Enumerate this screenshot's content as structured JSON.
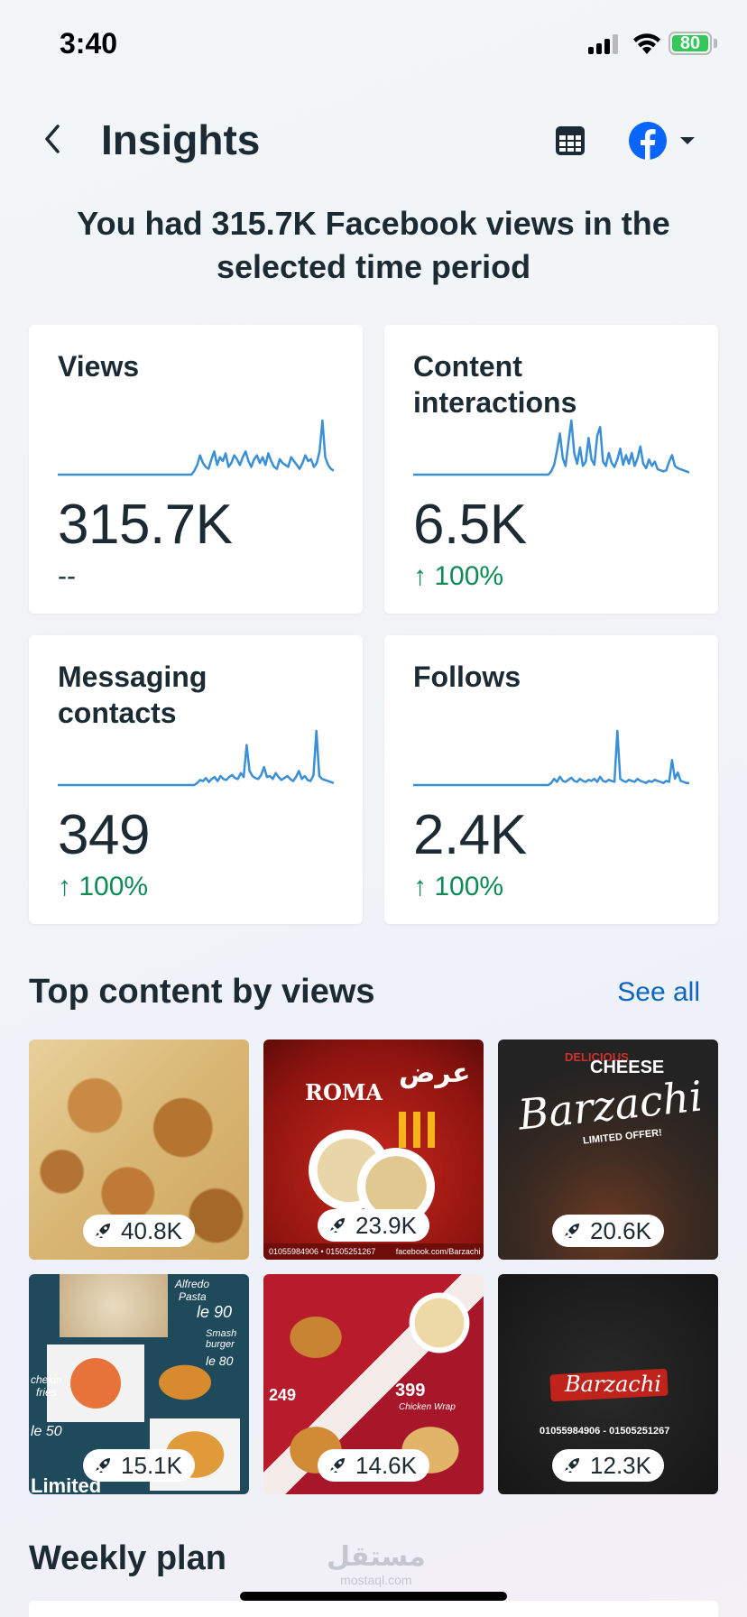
{
  "status_bar": {
    "time": "3:40",
    "battery": "80"
  },
  "header": {
    "title": "Insights"
  },
  "headline": "You had 315.7K Facebook views in the selected time period",
  "metrics": [
    {
      "label": "Views",
      "value": "315.7K",
      "change": "--",
      "trend": "none",
      "sparkline": [
        0,
        0,
        0,
        0,
        0,
        0,
        0,
        0,
        0,
        0,
        0,
        0,
        0,
        0,
        0,
        0,
        0,
        0,
        0,
        0,
        0,
        0,
        0,
        0,
        0,
        0,
        0,
        0,
        0,
        0,
        0,
        0,
        0,
        0,
        0,
        0,
        0,
        0,
        0,
        0,
        0,
        0,
        0,
        0,
        0,
        0,
        0,
        0,
        2,
        5,
        10,
        6,
        4,
        3,
        8,
        12,
        5,
        9,
        7,
        11,
        4,
        6,
        10,
        8,
        5,
        9,
        12,
        7,
        4,
        8,
        10,
        6,
        9,
        5,
        11,
        7,
        4,
        3,
        8,
        6,
        5,
        4,
        9,
        7,
        5,
        3,
        6,
        10,
        7,
        8,
        4,
        6,
        12,
        28,
        9,
        5,
        3,
        2
      ]
    },
    {
      "label": "Content interactions",
      "value": "6.5K",
      "change": "100%",
      "trend": "up",
      "sparkline": [
        0,
        0,
        0,
        0,
        0,
        0,
        0,
        0,
        0,
        0,
        0,
        0,
        0,
        0,
        0,
        0,
        0,
        0,
        0,
        0,
        0,
        0,
        0,
        0,
        0,
        0,
        0,
        0,
        0,
        0,
        0,
        0,
        0,
        0,
        0,
        0,
        0,
        0,
        0,
        0,
        0,
        0,
        0,
        0,
        0,
        0,
        0,
        0,
        3,
        9,
        22,
        38,
        15,
        8,
        30,
        50,
        20,
        10,
        25,
        8,
        12,
        34,
        14,
        9,
        36,
        44,
        12,
        8,
        20,
        11,
        7,
        14,
        24,
        9,
        18,
        10,
        20,
        8,
        15,
        26,
        10,
        6,
        14,
        8,
        12,
        5,
        4,
        3,
        4,
        12,
        18,
        8,
        6,
        5,
        4,
        3,
        2
      ]
    },
    {
      "label": "Messaging contacts",
      "value": "349",
      "change": "100%",
      "trend": "up",
      "sparkline": [
        0,
        0,
        0,
        0,
        0,
        0,
        0,
        0,
        0,
        0,
        0,
        0,
        0,
        0,
        0,
        0,
        0,
        0,
        0,
        0,
        0,
        0,
        0,
        0,
        0,
        0,
        0,
        0,
        0,
        0,
        0,
        0,
        0,
        0,
        0,
        0,
        0,
        0,
        0,
        0,
        0,
        0,
        0,
        0,
        0,
        0,
        0,
        0,
        2,
        5,
        4,
        7,
        3,
        6,
        8,
        4,
        9,
        6,
        5,
        8,
        10,
        7,
        6,
        12,
        8,
        40,
        14,
        9,
        7,
        6,
        10,
        18,
        8,
        9,
        6,
        12,
        8,
        5,
        7,
        9,
        6,
        4,
        8,
        14,
        6,
        9,
        5,
        4,
        10,
        54,
        9,
        6,
        5,
        4,
        3,
        2
      ]
    },
    {
      "label": "Follows",
      "value": "2.4K",
      "change": "100%",
      "trend": "up",
      "sparkline": [
        0,
        0,
        0,
        0,
        0,
        0,
        0,
        0,
        0,
        0,
        0,
        0,
        0,
        0,
        0,
        0,
        0,
        0,
        0,
        0,
        0,
        0,
        0,
        0,
        0,
        0,
        0,
        0,
        0,
        0,
        0,
        0,
        0,
        0,
        0,
        0,
        0,
        0,
        0,
        0,
        0,
        0,
        0,
        0,
        0,
        0,
        0,
        0,
        2,
        6,
        3,
        8,
        4,
        3,
        5,
        7,
        4,
        3,
        6,
        4,
        3,
        5,
        4,
        6,
        3,
        8,
        4,
        3,
        5,
        4,
        3,
        52,
        6,
        4,
        3,
        5,
        4,
        3,
        6,
        4,
        3,
        2,
        4,
        3,
        5,
        4,
        3,
        2,
        4,
        3,
        24,
        6,
        12,
        4,
        3,
        2,
        2
      ]
    }
  ],
  "top_content": {
    "title": "Top content by views",
    "see_all": "See all",
    "items": [
      {
        "views": "40.8K",
        "art": "pasta-chicken"
      },
      {
        "views": "23.9K",
        "art": "roma-offer",
        "texts": [
          "ROMA",
          "عرض",
          "01055984906 • 01505251267",
          "facebook.com/Barzachi"
        ]
      },
      {
        "views": "20.6K",
        "art": "barzachi-cheese",
        "texts": [
          "DELICIOUS",
          "CHEESE",
          "Barzachi",
          "LIMITED OFFER!"
        ]
      },
      {
        "views": "15.1K",
        "art": "menu-collage",
        "texts": [
          "Alfredo",
          "Pasta",
          "le 90",
          "Smash",
          "burger",
          "le 80",
          "chekin",
          "fries",
          "le 50",
          "Limited"
        ]
      },
      {
        "views": "14.6K",
        "art": "burger-wrap",
        "texts": [
          "249",
          "399",
          "Chicken Wrap"
        ]
      },
      {
        "views": "12.3K",
        "art": "barzachi-dark",
        "texts": [
          "Barzachi",
          "01055984906 - 01505251267"
        ]
      }
    ]
  },
  "weekly_plan": {
    "title": "Weekly plan"
  },
  "watermark": {
    "arabic": "مستقل",
    "latin": "mostaql.com"
  },
  "colors": {
    "accent": "#0a66c2",
    "sparkline": "#3b8fd6",
    "positive": "#0e8a55",
    "facebook": "#0866ff"
  },
  "icons": [
    "back-chevron-icon",
    "calendar-table-icon",
    "facebook-logo-icon",
    "dropdown-caret-icon",
    "rocket-boost-icon",
    "up-arrow-icon"
  ]
}
